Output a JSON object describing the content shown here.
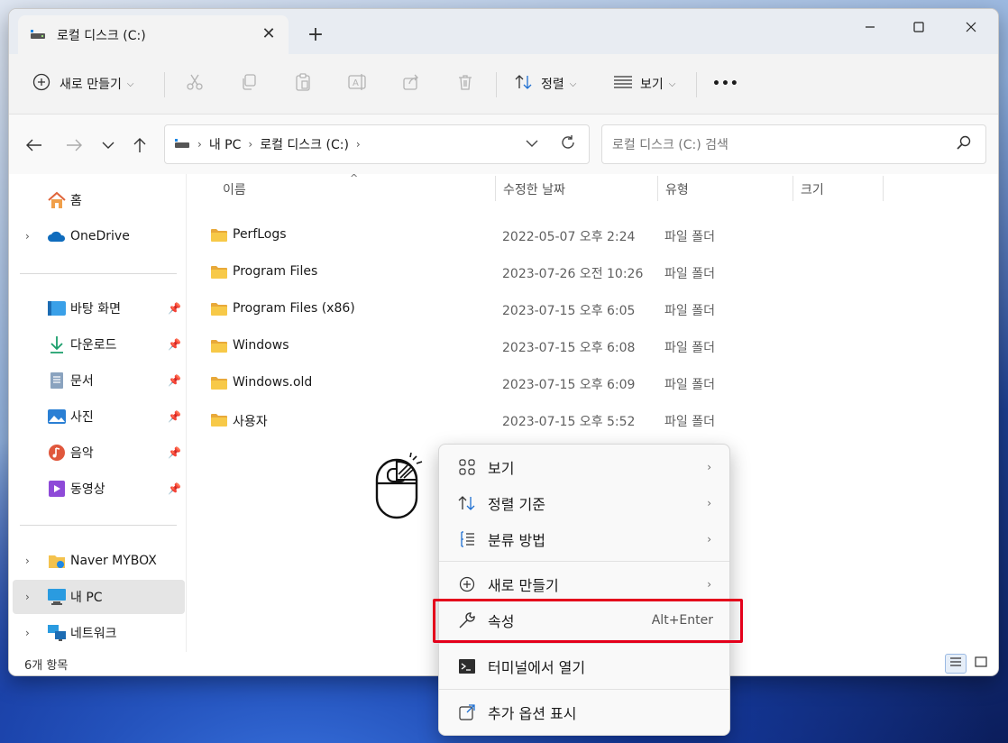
{
  "window": {
    "tab_title": "로컬 디스크 (C:)",
    "new_tab_symbol": "+"
  },
  "toolbar": {
    "new_label": "새로 만들기",
    "sort_label": "정렬",
    "view_label": "보기",
    "more_symbol": "•••"
  },
  "address": {
    "crumbs": [
      "내 PC",
      "로컬 디스크 (C:)"
    ],
    "search_placeholder": "로컬 디스크 (C:) 검색"
  },
  "sidebar": {
    "home": "홈",
    "onedrive": "OneDrive",
    "quick": [
      {
        "label": "바탕 화면",
        "icon": "desktop-icon"
      },
      {
        "label": "다운로드",
        "icon": "download-icon"
      },
      {
        "label": "문서",
        "icon": "document-icon"
      },
      {
        "label": "사진",
        "icon": "pictures-icon"
      },
      {
        "label": "음악",
        "icon": "music-icon"
      },
      {
        "label": "동영상",
        "icon": "video-icon"
      }
    ],
    "naver": "Naver MYBOX",
    "mypc": "내 PC",
    "network": "네트워크"
  },
  "columns": {
    "name": "이름",
    "date": "수정한 날짜",
    "type": "유형",
    "size": "크기"
  },
  "files": [
    {
      "name": "PerfLogs",
      "date": "2022-05-07 오후 2:24",
      "type": "파일 폴더"
    },
    {
      "name": "Program Files",
      "date": "2023-07-26 오전 10:26",
      "type": "파일 폴더"
    },
    {
      "name": "Program Files (x86)",
      "date": "2023-07-15 오후 6:05",
      "type": "파일 폴더"
    },
    {
      "name": "Windows",
      "date": "2023-07-15 오후 6:08",
      "type": "파일 폴더"
    },
    {
      "name": "Windows.old",
      "date": "2023-07-15 오후 6:09",
      "type": "파일 폴더"
    },
    {
      "name": "사용자",
      "date": "2023-07-15 오후 5:52",
      "type": "파일 폴더"
    }
  ],
  "status": {
    "count": "6개 항목"
  },
  "context_menu": {
    "view": "보기",
    "sort_by": "정렬 기준",
    "group_by": "분류 방법",
    "new": "새로 만들기",
    "properties": "속성",
    "properties_accel": "Alt+Enter",
    "terminal": "터미널에서 열기",
    "more_options": "추가 옵션 표시"
  },
  "colors": {
    "highlight": "#e4001b",
    "folder": "#f4c24d",
    "accent": "#0067c0"
  }
}
